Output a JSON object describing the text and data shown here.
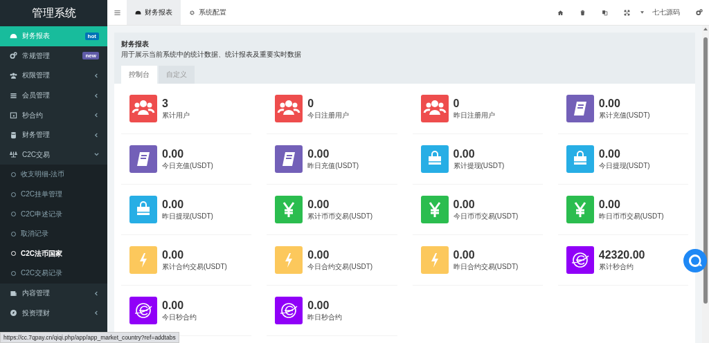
{
  "sidebar": {
    "title": "管理系统",
    "items": [
      {
        "label": "财务报表",
        "selected": true,
        "badge": {
          "text": "hot",
          "color": "#0073b7"
        }
      },
      {
        "label": "常规管理",
        "selected": false,
        "badge": {
          "text": "new",
          "color": "#605ca8"
        }
      },
      {
        "label": "权限管理",
        "selected": false,
        "expanded": false
      },
      {
        "label": "会员管理",
        "selected": false,
        "expanded": false
      },
      {
        "label": "秒合约",
        "selected": false,
        "expanded": false
      },
      {
        "label": "财务管理",
        "selected": false,
        "expanded": false
      },
      {
        "label": "C2C交易",
        "selected": false,
        "expanded": true,
        "children": [
          {
            "label": "收支明细-法币",
            "selected": false
          },
          {
            "label": "C2C挂单管理",
            "selected": false
          },
          {
            "label": "C2C申述记录",
            "selected": false
          },
          {
            "label": "取消记录",
            "selected": false
          },
          {
            "label": "C2C法币国家",
            "selected": true
          },
          {
            "label": "C2C交易记录",
            "selected": false
          }
        ]
      },
      {
        "label": "内容管理",
        "selected": false,
        "expanded": false
      },
      {
        "label": "投资理财",
        "selected": false,
        "expanded": false
      }
    ]
  },
  "header": {
    "tabs": [
      {
        "label": "财务报表",
        "selected": true
      },
      {
        "label": "系统配置",
        "selected": false
      }
    ],
    "user": "七七源码"
  },
  "panel": {
    "title": "财务报表",
    "description": "用于展示当前系统中的统计数据、统计报表及重要实时数据",
    "tabs": [
      {
        "label": "控制台",
        "selected": true
      },
      {
        "label": "自定义",
        "selected": false
      }
    ],
    "stats": [
      {
        "kind": "users",
        "value": "3",
        "label": "累计用户"
      },
      {
        "kind": "users",
        "value": "0",
        "label": "今日注册用户"
      },
      {
        "kind": "users",
        "value": "0",
        "label": "昨日注册用户"
      },
      {
        "kind": "book",
        "value": "0.00",
        "label": "累计充值(USDT)"
      },
      {
        "kind": "book",
        "value": "0.00",
        "label": "今日充值(USDT)"
      },
      {
        "kind": "book",
        "value": "0.00",
        "label": "昨日充值(USDT)"
      },
      {
        "kind": "bag",
        "value": "0.00",
        "label": "累计提现(USDT)"
      },
      {
        "kind": "bag",
        "value": "0.00",
        "label": "今日提现(USDT)"
      },
      {
        "kind": "bag",
        "value": "0.00",
        "label": "昨日提现(USDT)"
      },
      {
        "kind": "yen",
        "value": "0.00",
        "label": "累计币币交易(USDT)"
      },
      {
        "kind": "yen",
        "value": "0.00",
        "label": "今日币币交易(USDT)"
      },
      {
        "kind": "yen",
        "value": "0.00",
        "label": "昨日币币交易(USDT)"
      },
      {
        "kind": "bolt",
        "value": "0.00",
        "label": "累计合约交易(USDT)"
      },
      {
        "kind": "bolt",
        "value": "0.00",
        "label": "今日合约交易(USDT)"
      },
      {
        "kind": "bolt",
        "value": "0.00",
        "label": "昨日合约交易(USDT)"
      },
      {
        "kind": "globe",
        "value": "42320.00",
        "label": "累计秒合约"
      },
      {
        "kind": "globe",
        "value": "0.00",
        "label": "今日秒合约"
      },
      {
        "kind": "globe",
        "value": "0.00",
        "label": "昨日秒合约"
      }
    ]
  },
  "status_url": "https://cc.7qpay.cn/qiqi.php/app/app_market_country?ref=addtabs"
}
